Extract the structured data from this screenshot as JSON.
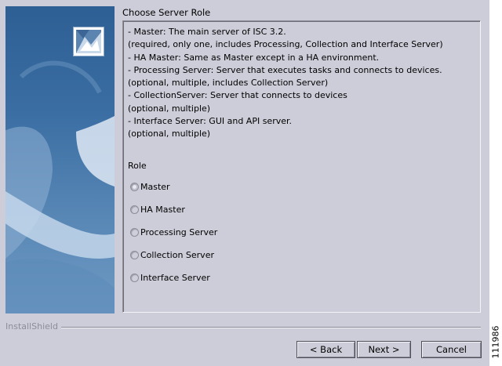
{
  "section_title": "Choose Server Role",
  "description_lines": [
    "- Master: The main server of ISC 3.2.",
    "(required, only one, includes Processing, Collection and Interface Server)",
    "- HA Master: Same as Master except in a HA environment.",
    "- Processing Server: Server that executes tasks and connects to devices.",
    "(optional, multiple, includes Collection Server)",
    "- CollectionServer: Server that connects to devices",
    "(optional, multiple)",
    "- Interface Server: GUI and API server.",
    "(optional, multiple)"
  ],
  "role_label": "Role",
  "roles": [
    {
      "label": "Master",
      "selected": true
    },
    {
      "label": "HA Master",
      "selected": false
    },
    {
      "label": "Processing Server",
      "selected": false
    },
    {
      "label": "Collection Server",
      "selected": false
    },
    {
      "label": "Interface Server",
      "selected": false
    }
  ],
  "installshield_label": "InstallShield",
  "buttons": {
    "back": "< Back",
    "next": "Next >",
    "cancel": "Cancel"
  },
  "figure_number": "111986",
  "icons": {
    "logo": "installshield-logo-icon"
  }
}
